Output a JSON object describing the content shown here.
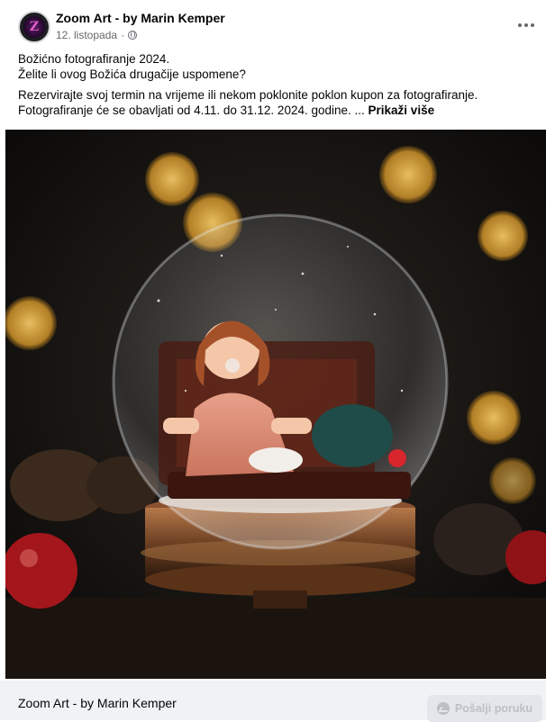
{
  "post": {
    "page_name": "Zoom Art - by Marin Kemper",
    "date": "12. listopada",
    "dot": "·",
    "avatar_letter": "Z",
    "text_lines": [
      "Božićno fotografiranje 2024.",
      "Želite li ovog Božića drugačije uspomene?"
    ],
    "paragraph": "Rezervirajte svoj termin na vrijeme ili nekom poklonite poklon kupon za fotografiranje. Fotografiranje će se obavljati od 4.11. do 31.12. 2024. godine. ...",
    "see_more": "Prikaži više"
  },
  "footer": {
    "page_name": "Zoom Art - by Marin Kemper",
    "message_button": "Pošalji poruku"
  },
  "icons": {
    "more": "more-options-icon",
    "privacy": "globe-icon",
    "messenger": "messenger-icon"
  },
  "colors": {
    "secondary_text": "#65676b",
    "footer_bg": "#f0f2f5",
    "button_bg": "#e4e6eb",
    "disabled_text": "#bcc0c4"
  }
}
